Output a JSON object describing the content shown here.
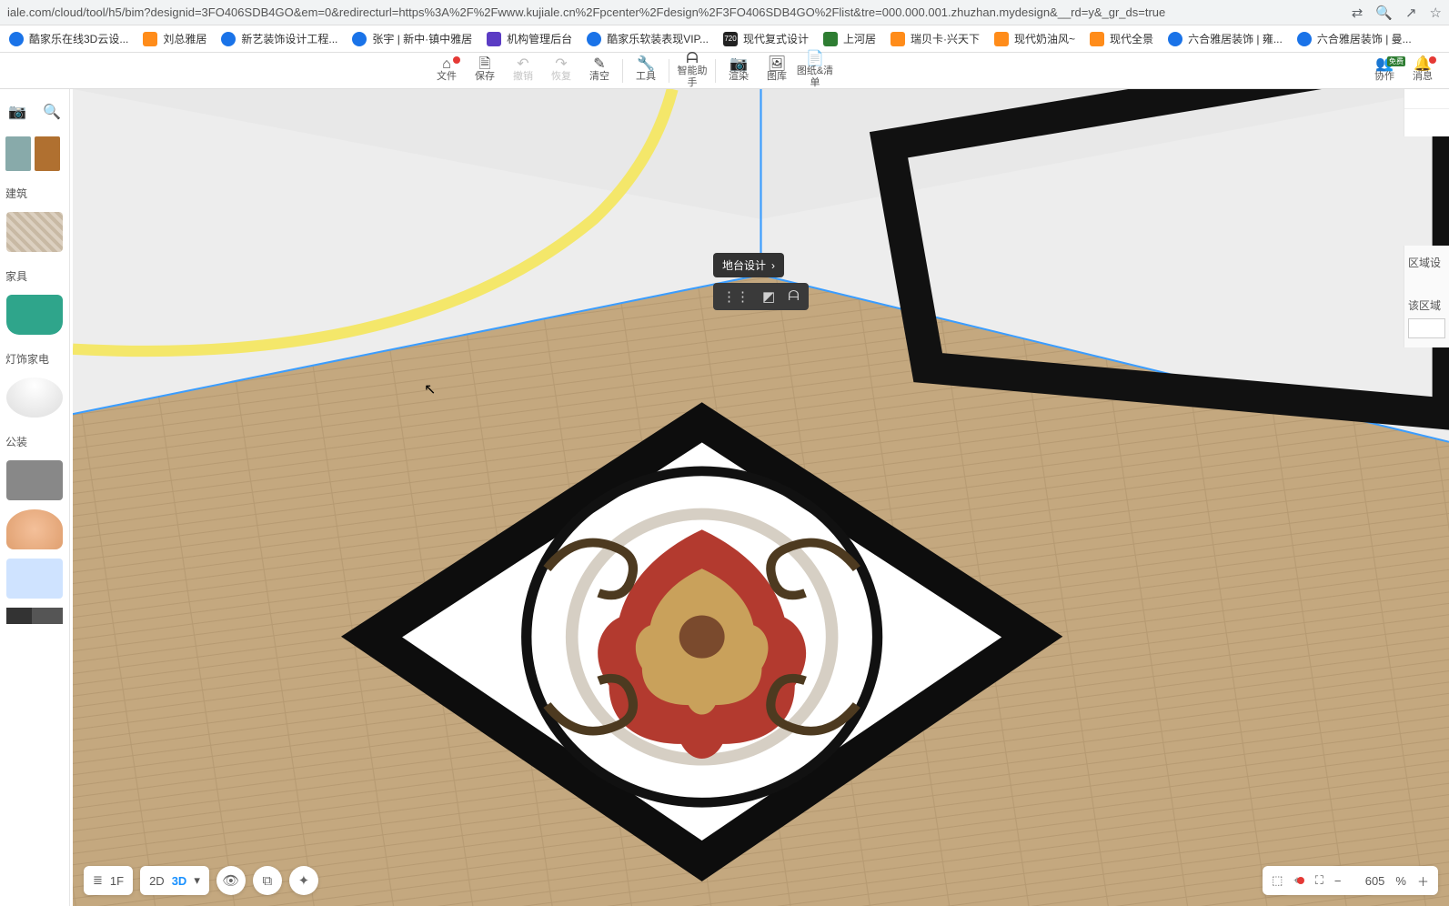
{
  "url": "iale.com/cloud/tool/h5/bim?designid=3FO406SDB4GO&em=0&redirecturl=https%3A%2F%2Fwww.kujiale.cn%2Fpcenter%2Fdesign%2F3FO406SDB4GO%2Flist&tre=000.000.001.zhuzhan.mydesign&__rd=y&_gr_ds=true",
  "bookmarks": [
    "酷家乐在线3D云设...",
    "刘总雅居",
    "新艺装饰设计工程...",
    "张宇 | 新中·镇中雅居",
    "机构管理后台",
    "酷家乐软装表现VIP...",
    "现代复式设计",
    "上河居",
    "瑞贝卡·兴天下",
    "现代奶油风~",
    "现代全景",
    "六合雅居装饰 | 雍...",
    "六合雅居装饰 | 曼..."
  ],
  "toolbar": {
    "file": "文件",
    "save": "保存",
    "undo": "撤销",
    "redo": "恢复",
    "clear": "清空",
    "tools": "工具",
    "ai": "智能助手",
    "render": "渲染",
    "gallery": "图库",
    "drawings": "图纸&清单",
    "collab": "协作",
    "msgs": "消息"
  },
  "sidebar": {
    "cat_build": "建筑",
    "cat_furn": "家具",
    "cat_light": "灯饰家电",
    "cat_public": "公装"
  },
  "context": {
    "label": "地台设计"
  },
  "view": {
    "floor": "1F",
    "mode2d": "2D",
    "mode3d": "3D"
  },
  "zoom": {
    "value": "605",
    "unit": "%"
  },
  "right": {
    "region": "区域设",
    "region_tip": "该区域"
  }
}
